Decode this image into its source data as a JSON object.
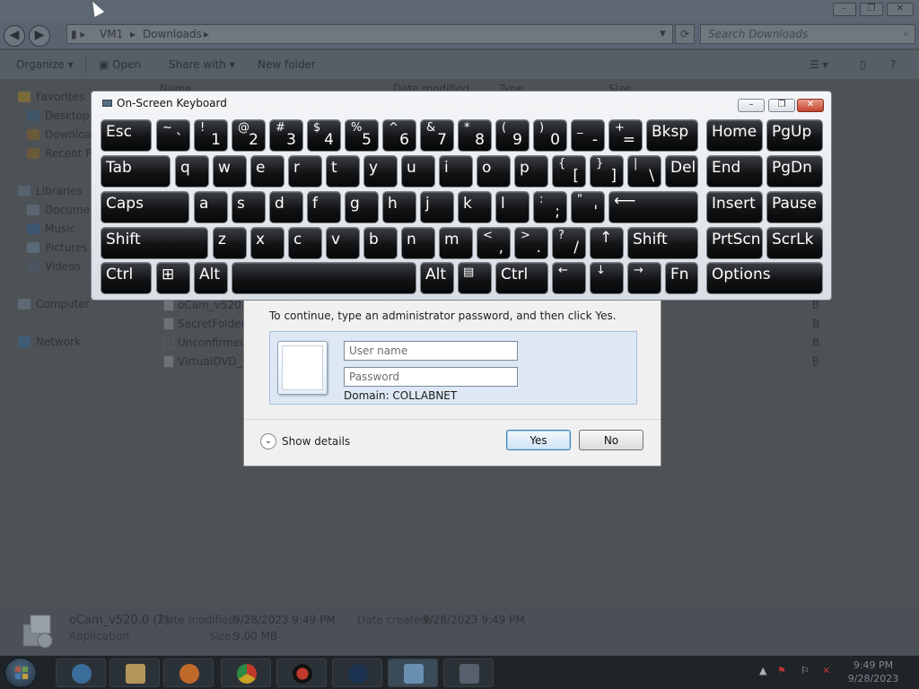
{
  "explorer": {
    "window_controls": [
      "–",
      "❐",
      "✕"
    ],
    "breadcrumb": [
      "VM1",
      "Downloads"
    ],
    "search_placeholder": "Search Downloads",
    "toolbar": {
      "organize": "Organize",
      "open": "Open",
      "share_with": "Share with",
      "new_folder": "New folder"
    },
    "column_headers": {
      "name": "Name",
      "date_modified": "Date modified",
      "type": "Type",
      "size": "Size"
    },
    "nav": {
      "favorites": "Favorites",
      "desktop": "Desktop",
      "downloads": "Downloads",
      "recent_places": "Recent Places",
      "libraries": "Libraries",
      "documents": "Documents",
      "music": "Music",
      "pictures": "Pictures",
      "videos": "Videos",
      "computer": "Computer",
      "network": "Network"
    },
    "files": [
      "oCam_v520.0",
      "SecretFolder_v",
      "Unconfirmed",
      "VirtualDVD_v9"
    ],
    "file_size_suffix": "B",
    "details": {
      "name": "oCam_v520.0 (2)",
      "type": "Application",
      "date_modified_label": "Date modified:",
      "date_modified": "9/28/2023 9:49 PM",
      "date_created_label": "Date created:",
      "date_created": "9/28/2023 9:49 PM",
      "size_label": "Size:",
      "size": "9.00 MB"
    }
  },
  "uac": {
    "message": "To continue, type an administrator password, and then click Yes.",
    "username_placeholder": "User name",
    "password_placeholder": "Password",
    "domain": "Domain: COLLABNET",
    "show_details": "Show details",
    "yes": "Yes",
    "no": "No"
  },
  "osk": {
    "title": "On-Screen Keyboard",
    "keys": {
      "esc": "Esc",
      "tilde_top": "~",
      "tilde_main": "`",
      "k1_top": "!",
      "k1": "1",
      "k2_top": "@",
      "k2": "2",
      "k3_top": "#",
      "k3": "3",
      "k4_top": "$",
      "k4": "4",
      "k5_top": "%",
      "k5": "5",
      "k6_top": "^",
      "k6": "6",
      "k7_top": "&",
      "k7": "7",
      "k8_top": "*",
      "k8": "8",
      "k9_top": "(",
      "k9": "9",
      "k0_top": ")",
      "k0": "0",
      "minus_top": "_",
      "minus": "-",
      "eq_top": "+",
      "eq": "=",
      "bksp": "Bksp",
      "home": "Home",
      "pgup": "PgUp",
      "tab": "Tab",
      "q": "q",
      "w": "w",
      "e": "e",
      "r": "r",
      "t": "t",
      "y": "y",
      "u": "u",
      "i": "i",
      "o": "o",
      "p": "p",
      "lbr_top": "{",
      "lbr": "[",
      "rbr_top": "}",
      "rbr": "]",
      "bsl_top": "|",
      "bsl": "\\",
      "del": "Del",
      "end": "End",
      "pgdn": "PgDn",
      "caps": "Caps",
      "a": "a",
      "s": "s",
      "d": "d",
      "f": "f",
      "g": "g",
      "h": "h",
      "j": "j",
      "k": "k",
      "l": "l",
      "semi_top": ":",
      "semi": ";",
      "quote_top": "\"",
      "quote": "'",
      "enter": "⟵",
      "insert": "Insert",
      "pause": "Pause",
      "shift": "Shift",
      "z": "z",
      "x": "x",
      "c": "c",
      "v": "v",
      "b": "b",
      "n": "n",
      "m": "m",
      "comma_top": "<",
      "comma": ",",
      "period_top": ">",
      "period": ".",
      "slash_top": "?",
      "slash": "/",
      "up": "↑",
      "prtscn": "PrtScn",
      "scrlk": "ScrLk",
      "ctrl": "Ctrl",
      "win": "⊞",
      "alt": "Alt",
      "menu": "▤",
      "left": "←",
      "down": "↓",
      "right": "→",
      "fn": "Fn",
      "options": "Options"
    }
  },
  "taskbar": {
    "clock_time": "9:49 PM",
    "clock_date": "9/28/2023"
  }
}
